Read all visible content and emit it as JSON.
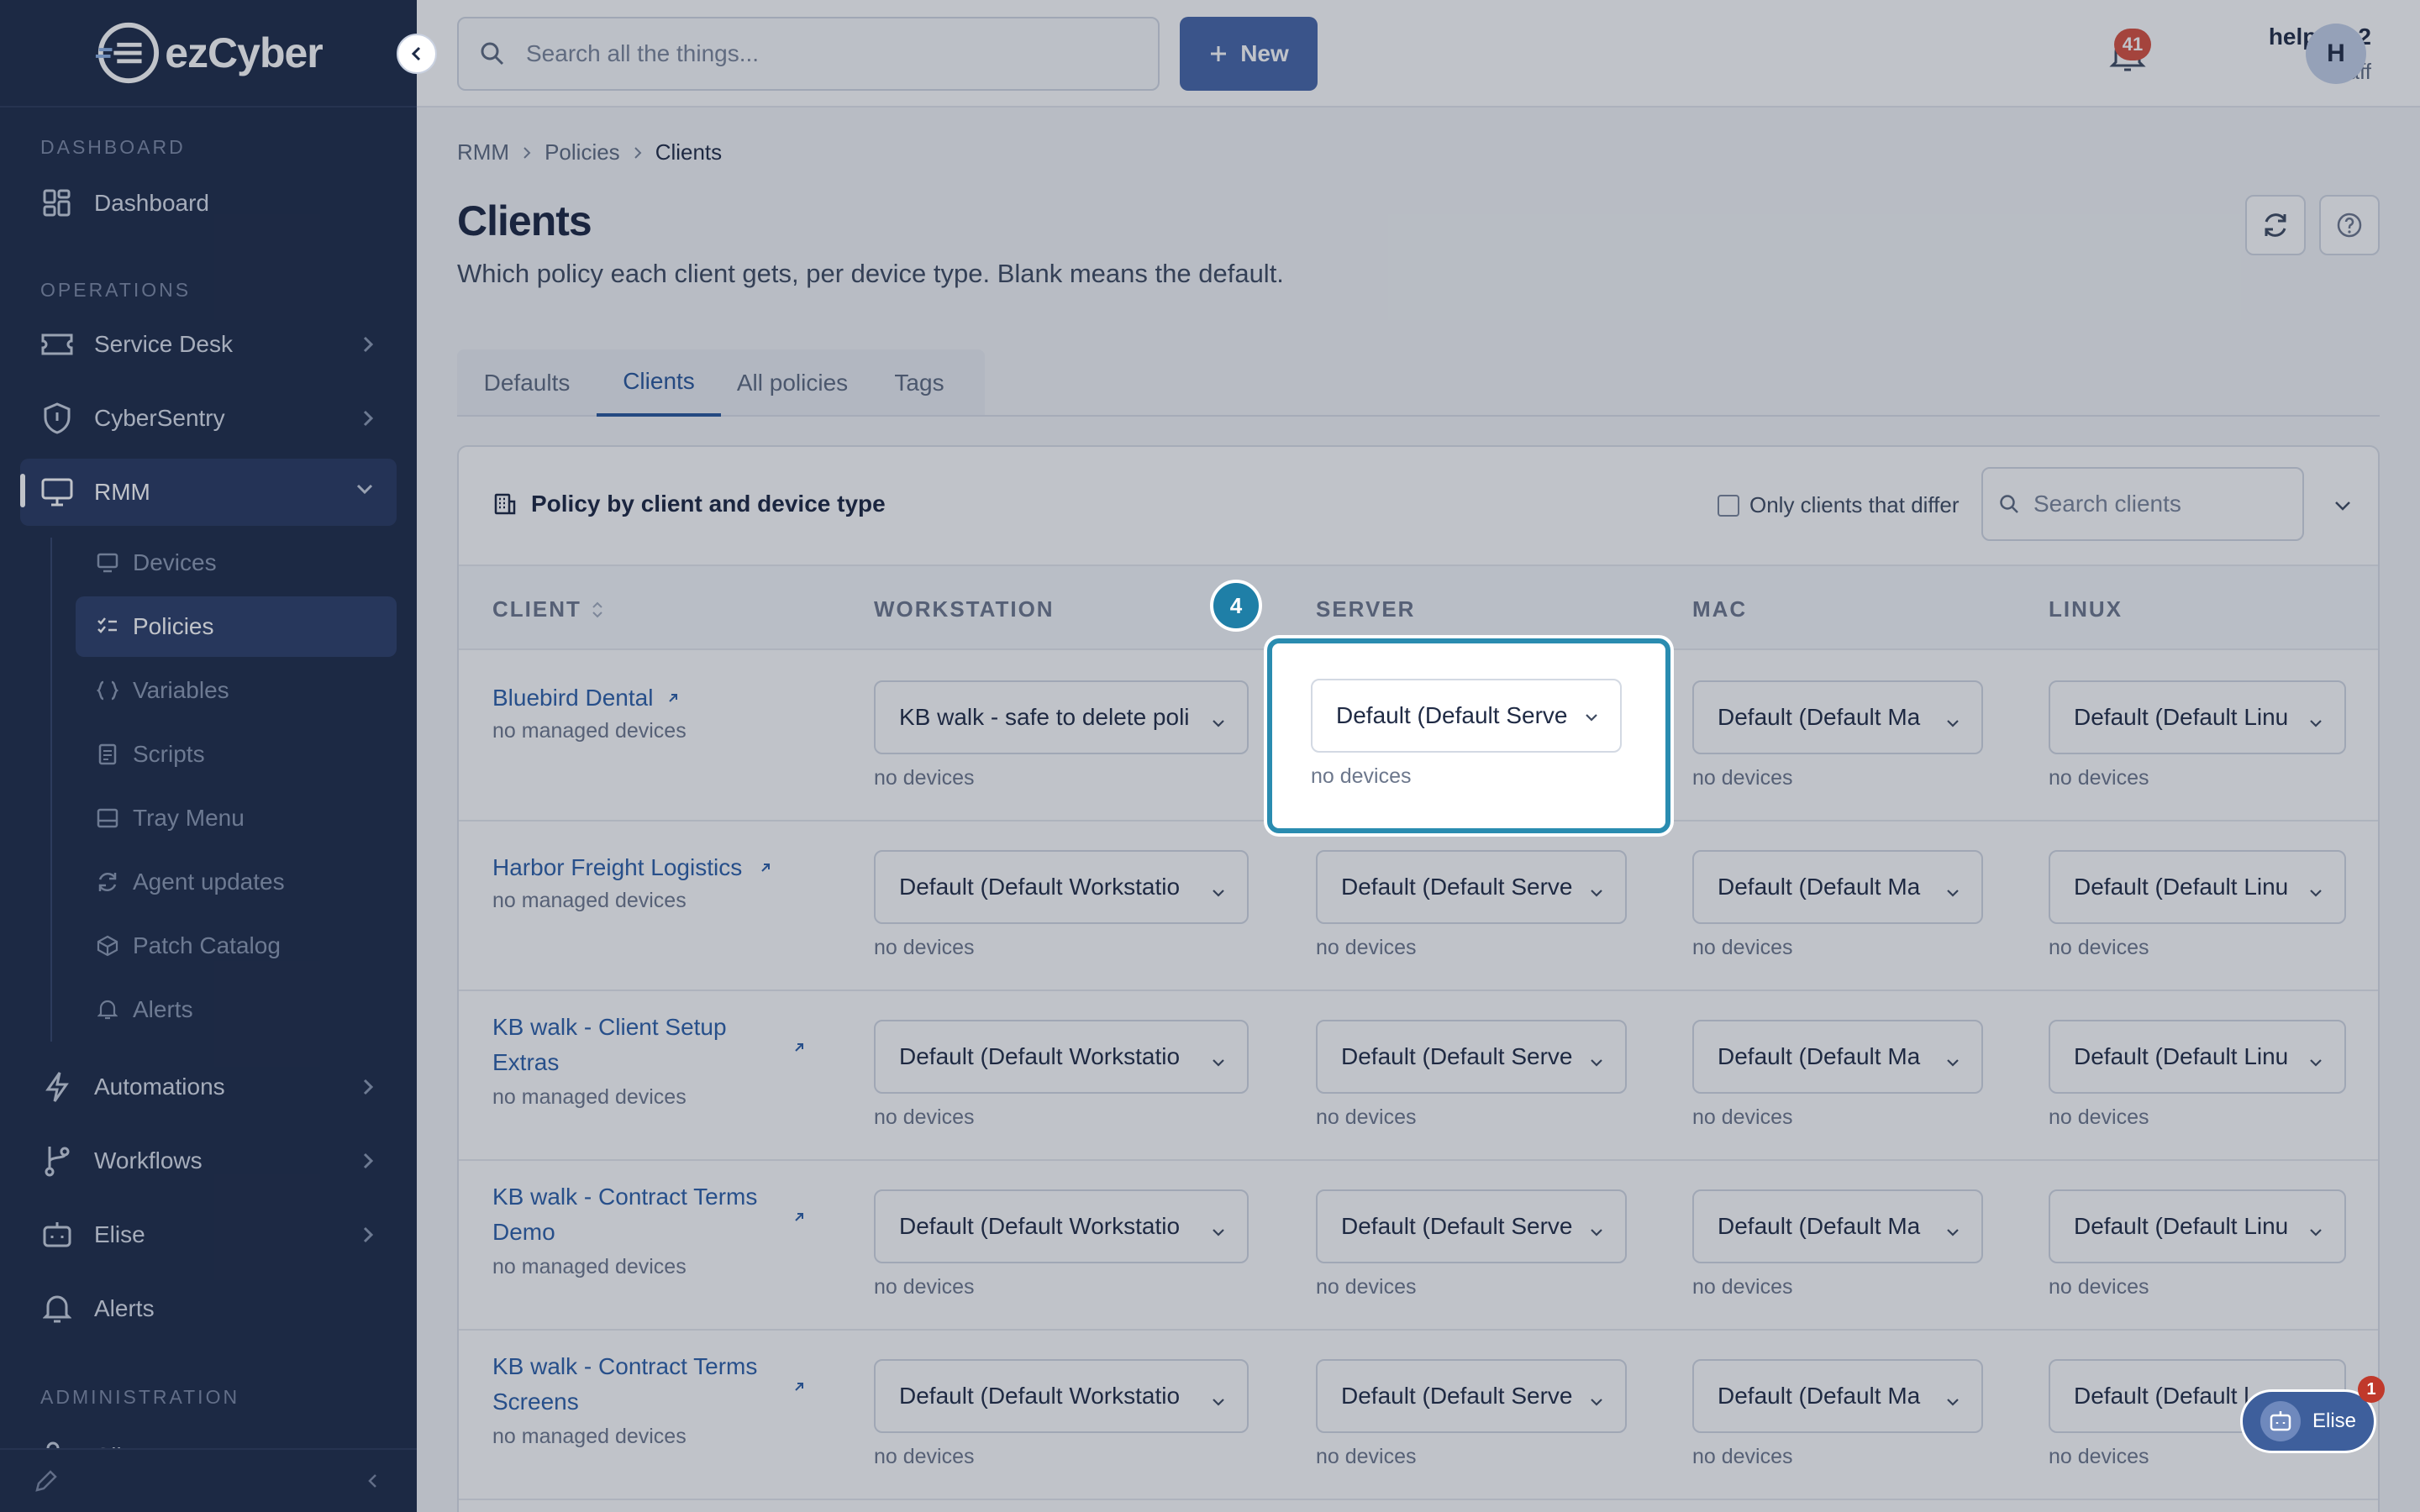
{
  "brand": {
    "name": "ezCyber"
  },
  "topbar": {
    "search_placeholder": "Search all the things...",
    "new_label": "New",
    "notification_count": "41",
    "user_name": "help+kb2",
    "user_role": "Staff",
    "avatar_initial": "H"
  },
  "sidebar": {
    "sections": [
      "DASHBOARD",
      "OPERATIONS",
      "ADMINISTRATION"
    ],
    "items": [
      {
        "label": "Dashboard",
        "icon": "dashboard-icon"
      },
      {
        "label": "Service Desk",
        "icon": "ticket-icon"
      },
      {
        "label": "CyberSentry",
        "icon": "shield-icon"
      },
      {
        "label": "RMM",
        "icon": "monitor-icon"
      },
      {
        "label": "Automations",
        "icon": "bolt-icon"
      },
      {
        "label": "Workflows",
        "icon": "workflow-icon"
      },
      {
        "label": "Elise",
        "icon": "robot-icon"
      },
      {
        "label": "Alerts",
        "icon": "bell-icon"
      },
      {
        "label": "Clients",
        "icon": "users-icon"
      }
    ],
    "rmm_sub": [
      {
        "label": "Devices"
      },
      {
        "label": "Policies"
      },
      {
        "label": "Variables"
      },
      {
        "label": "Scripts"
      },
      {
        "label": "Tray Menu"
      },
      {
        "label": "Agent updates"
      },
      {
        "label": "Patch Catalog"
      },
      {
        "label": "Alerts"
      }
    ]
  },
  "breadcrumb": [
    "RMM",
    "Policies",
    "Clients"
  ],
  "page": {
    "title": "Clients",
    "subtitle": "Which policy each client gets, per device type. Blank means the default."
  },
  "tabs": [
    "Defaults",
    "Clients",
    "All policies",
    "Tags"
  ],
  "card": {
    "title": "Policy by client and device type",
    "filter_label": "Only clients that differ",
    "search_placeholder": "Search clients"
  },
  "table": {
    "headers": [
      "CLIENT",
      "WORKSTATION",
      "SERVER",
      "MAC",
      "LINUX"
    ],
    "rows": [
      {
        "client": "Bluebird Dental",
        "meta": "no managed devices",
        "workstation": "KB walk - safe to delete poli",
        "server": "Default (Default Serve",
        "mac": "Default (Default Ma",
        "linux": "Default (Default Linu",
        "note": "no devices"
      },
      {
        "client": "Harbor Freight Logistics",
        "meta": "no managed devices",
        "workstation": "Default (Default Workstatio",
        "server": "Default (Default Serve",
        "mac": "Default (Default Ma",
        "linux": "Default (Default Linu",
        "note": "no devices"
      },
      {
        "client": "KB walk - Client Setup Extras",
        "meta": "no managed devices",
        "workstation": "Default (Default Workstatio",
        "server": "Default (Default Serve",
        "mac": "Default (Default Ma",
        "linux": "Default (Default Linu",
        "note": "no devices"
      },
      {
        "client": "KB walk - Contract Terms Demo",
        "meta": "no managed devices",
        "workstation": "Default (Default Workstatio",
        "server": "Default (Default Serve",
        "mac": "Default (Default Ma",
        "linux": "Default (Default Linu",
        "note": "no devices"
      },
      {
        "client": "KB walk - Contract Terms Screens",
        "meta": "no managed devices",
        "workstation": "Default (Default Workstatio",
        "server": "Default (Default Serve",
        "mac": "Default (Default Ma",
        "linux": "Default (Default l",
        "note": "no devices"
      }
    ]
  },
  "tour": {
    "step": "4"
  },
  "assistant": {
    "label": "Elise",
    "badge": "1"
  },
  "colors": {
    "sidebar": "#1d2a47",
    "accent": "#4666a8",
    "highlight": "#2a8cb0"
  }
}
